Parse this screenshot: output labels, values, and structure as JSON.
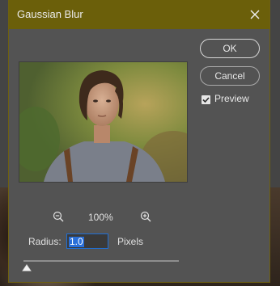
{
  "dialog": {
    "title": "Gaussian Blur",
    "close_icon": "close-icon"
  },
  "buttons": {
    "ok_label": "OK",
    "cancel_label": "Cancel"
  },
  "preview_option": {
    "label": "Preview",
    "checked": true
  },
  "zoom": {
    "level": "100%",
    "zoom_out_icon": "zoom-out-icon",
    "zoom_in_icon": "zoom-in-icon"
  },
  "radius": {
    "label": "Radius:",
    "value": "1.0",
    "unit": "Pixels"
  },
  "slider": {
    "position_fraction": 0.02
  },
  "colors": {
    "titlebar": "#6b5f0a",
    "dialog_bg": "#535353",
    "selection": "#2a6fd8"
  }
}
